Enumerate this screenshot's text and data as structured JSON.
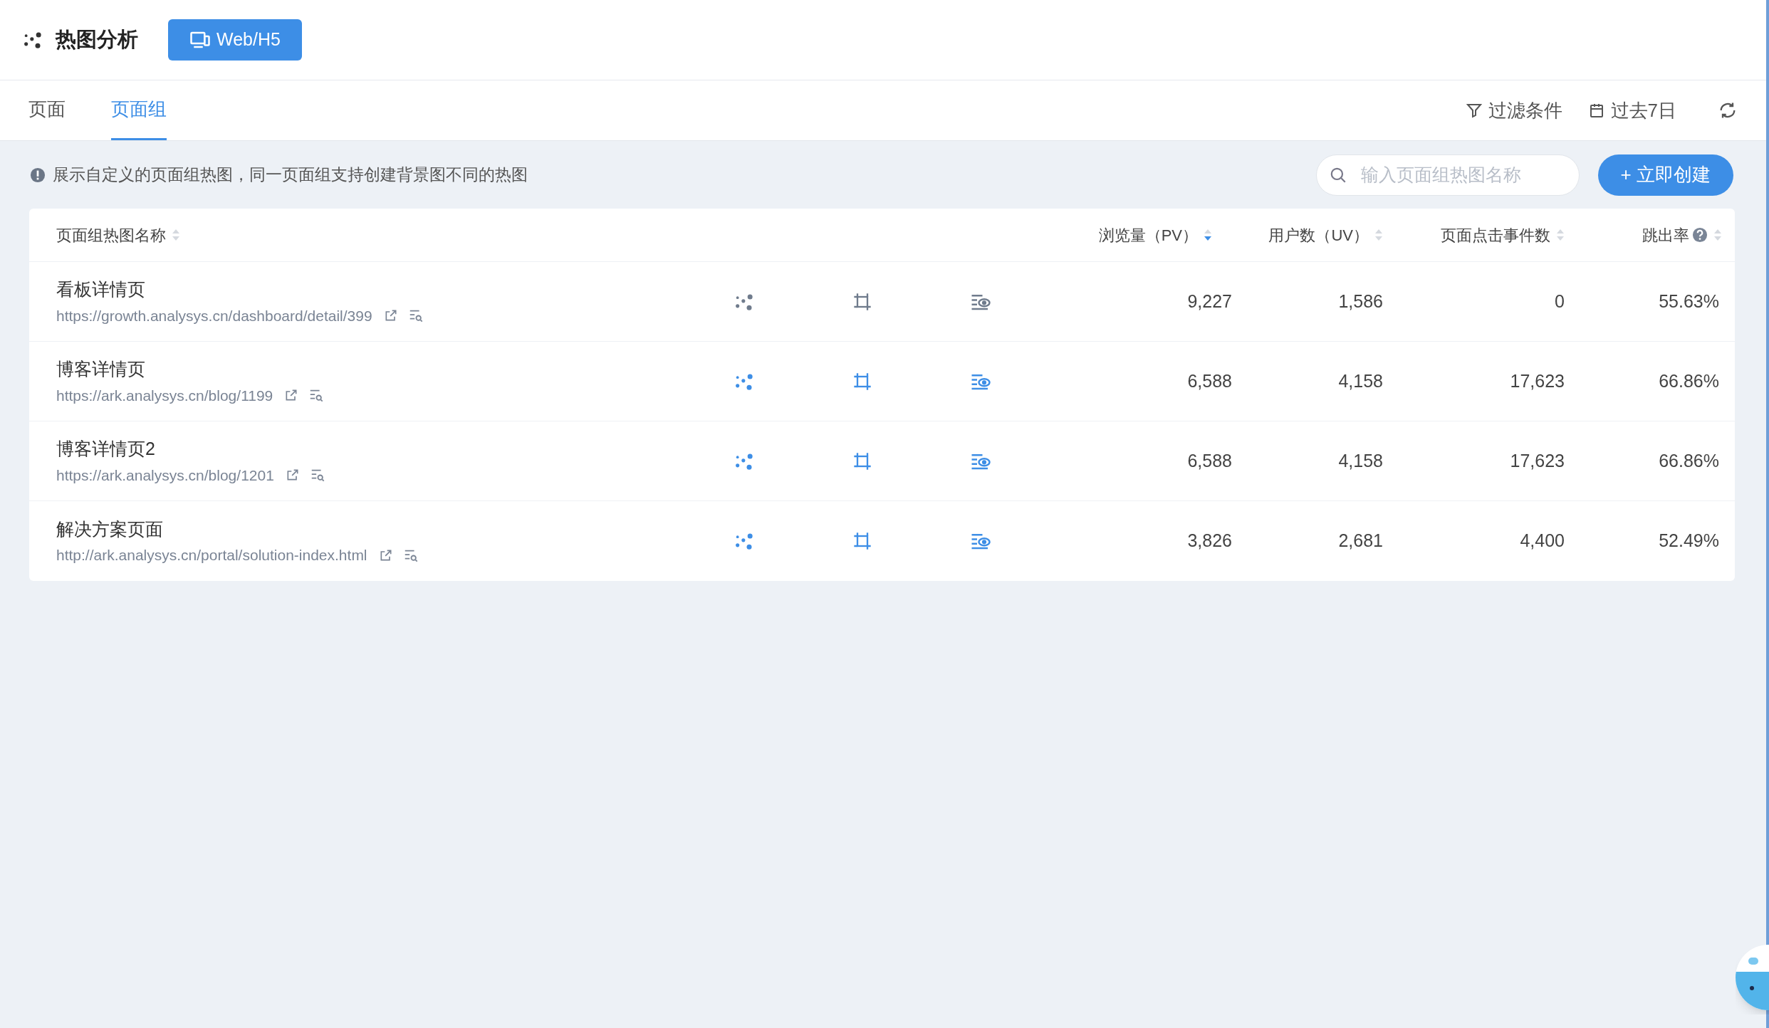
{
  "header": {
    "title": "热图分析",
    "platform_button": "Web/H5"
  },
  "tabs": [
    {
      "label": "页面",
      "selected": false
    },
    {
      "label": "页面组",
      "selected": true
    }
  ],
  "toolbar": {
    "filter": "过滤条件",
    "date_range": "过去7日"
  },
  "info": "展示自定义的页面组热图，同一页面组支持创建背景图不同的热图",
  "search": {
    "placeholder": "输入页面组热图名称"
  },
  "create_button": "+ 立即创建",
  "table": {
    "columns": [
      {
        "label": "页面组热图名称",
        "sorted_desc": false,
        "help": false
      },
      {
        "label": "浏览量（PV）",
        "sorted_desc": true,
        "help": false
      },
      {
        "label": "用户数（UV）",
        "sorted_desc": false,
        "help": false
      },
      {
        "label": "页面点击事件数",
        "sorted_desc": false,
        "help": false
      },
      {
        "label": "跳出率",
        "sorted_desc": false,
        "help": true
      }
    ],
    "rows": [
      {
        "name": "看板详情页",
        "url": "https://growth.analysys.cn/dashboard/detail/399",
        "icons_muted": true,
        "pv": "9,227",
        "uv": "1,586",
        "clicks": "0",
        "bounce": "55.63%"
      },
      {
        "name": "博客详情页",
        "url": "https://ark.analysys.cn/blog/1199",
        "icons_muted": false,
        "pv": "6,588",
        "uv": "4,158",
        "clicks": "17,623",
        "bounce": "66.86%"
      },
      {
        "name": "博客详情页2",
        "url": "https://ark.analysys.cn/blog/1201",
        "icons_muted": false,
        "pv": "6,588",
        "uv": "4,158",
        "clicks": "17,623",
        "bounce": "66.86%"
      },
      {
        "name": "解决方案页面",
        "url": "http://ark.analysys.cn/portal/solution-index.html",
        "icons_muted": false,
        "pv": "3,826",
        "uv": "2,681",
        "clicks": "4,400",
        "bounce": "52.49%"
      }
    ]
  }
}
